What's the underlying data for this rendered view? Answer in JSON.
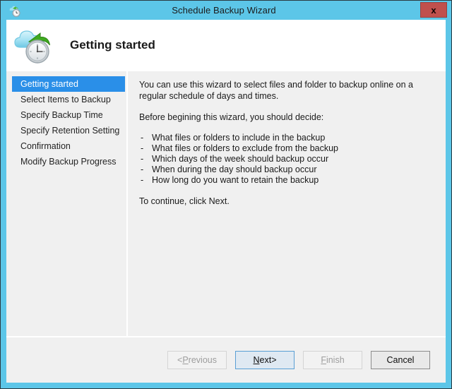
{
  "window": {
    "title": "Schedule Backup Wizard",
    "icon": "cloud-backup-clock-icon",
    "close_label": "x",
    "accent_color": "#5cc6e8",
    "close_button_color": "#c0504d"
  },
  "banner": {
    "icon": "cloud-upload-clock-icon",
    "title": "Getting started"
  },
  "sidebar": {
    "selected_index": 0,
    "highlight_color": "#2a8fe8",
    "items": [
      {
        "label": "Getting started",
        "selected": true
      },
      {
        "label": "Select Items to Backup",
        "selected": false
      },
      {
        "label": "Specify Backup Time",
        "selected": false
      },
      {
        "label": "Specify Retention Setting",
        "selected": false
      },
      {
        "label": "Confirmation",
        "selected": false
      },
      {
        "label": "Modify Backup Progress",
        "selected": false
      }
    ]
  },
  "content": {
    "intro": "You can use this wizard to select files and folder to backup online on a regular schedule of days and times.",
    "decide_heading": "Before begining this wizard, you should decide:",
    "bullet_marker": "-",
    "bullets": [
      "What files or folders to include in the backup",
      "What files or folders to exclude from the backup",
      "Which days of the week should backup occur",
      "When during the day should backup occur",
      "How long do you want to retain the backup"
    ],
    "continue_text": "To continue, click Next."
  },
  "footer": {
    "buttons": [
      {
        "name": "previous-button",
        "prefix": "< ",
        "accel": "P",
        "rest": "revious",
        "suffix": "",
        "state": "disabled"
      },
      {
        "name": "next-button",
        "prefix": "",
        "accel": "N",
        "rest": "ext",
        "suffix": " >",
        "state": "default"
      },
      {
        "name": "finish-button",
        "prefix": "",
        "accel": "F",
        "rest": "inish",
        "suffix": "",
        "state": "disabled"
      },
      {
        "name": "cancel-button",
        "prefix": "",
        "accel": "",
        "rest": "Cancel",
        "suffix": "",
        "state": "plain"
      }
    ]
  }
}
